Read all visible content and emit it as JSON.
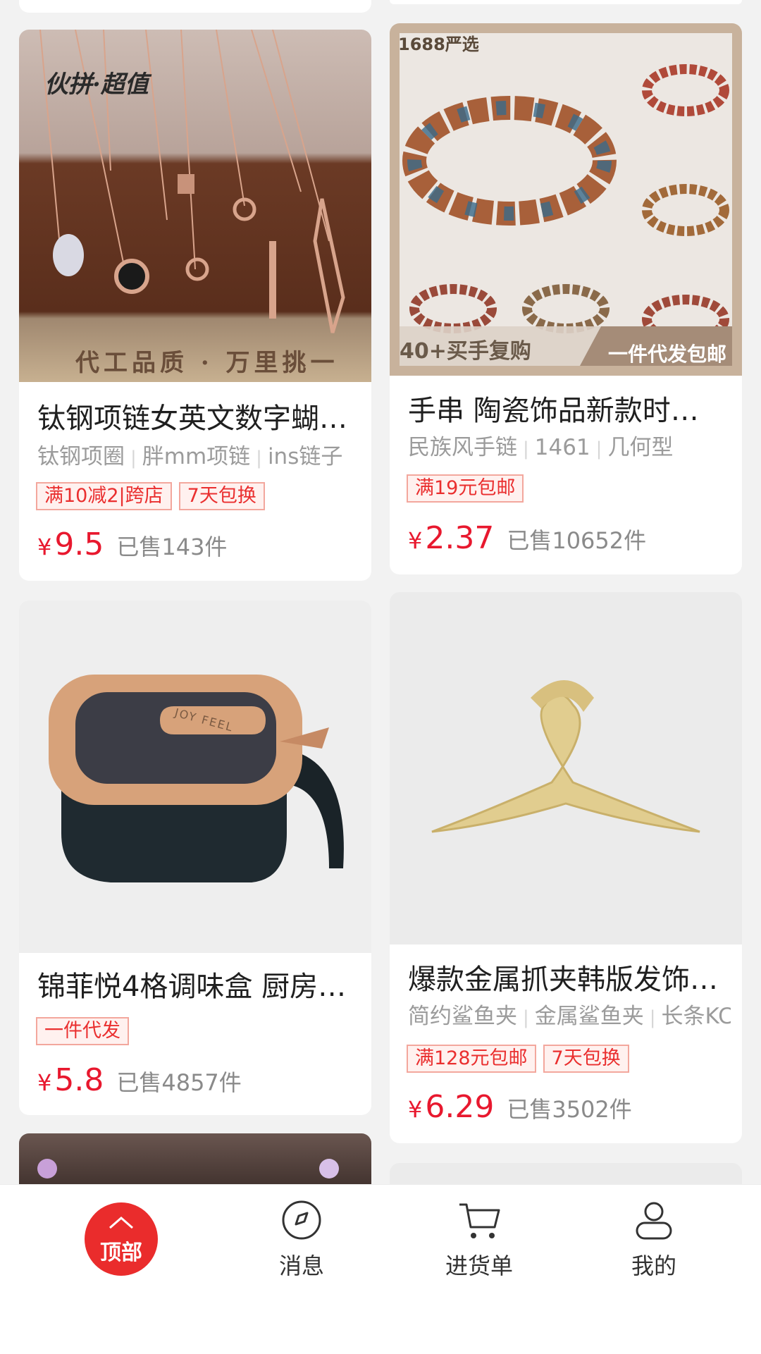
{
  "products": [
    {
      "title": "钛钢项链女英文数字蝴…",
      "tags": [
        "钛钢项圈",
        "胖mm项链",
        "ins链子"
      ],
      "promos": [
        "满10减2|跨店",
        "7天包换"
      ],
      "price_symbol": "¥",
      "price": "9.5",
      "sold": "已售143件",
      "image_badge_top": "伙拼·超值",
      "image_badge_bottom": "代工品质 · 万里挑一"
    },
    {
      "title": "手串 陶瓷饰品新款时…",
      "tags": [
        "民族风手链",
        "1461",
        "几何型"
      ],
      "promos": [
        "满19元包邮"
      ],
      "price_symbol": "¥",
      "price": "2.37",
      "sold": "已售10652件",
      "image_badge_top": "1688严选",
      "image_caption_left": "40+买手复购",
      "image_caption_right": "一件代发包邮"
    },
    {
      "title": "锦菲悦4格调味盒 厨房…",
      "tags": [],
      "promos": [
        "一件代发"
      ],
      "price_symbol": "¥",
      "price": "5.8",
      "sold": "已售4857件",
      "image_brand_text": "JOY FEEL"
    },
    {
      "title": "爆款金属抓夹韩版发饰…",
      "tags": [
        "简约鲨鱼夹",
        "金属鲨鱼夹",
        "长条KC"
      ],
      "promos": [
        "满128元包邮",
        "7天包换"
      ],
      "price_symbol": "¥",
      "price": "6.29",
      "sold": "已售3502件"
    }
  ],
  "tabbar": {
    "top_label": "顶部",
    "messages_label": "消息",
    "cart_label": "进货单",
    "mine_label": "我的"
  },
  "colors": {
    "accent": "#e8182e",
    "promo_border": "#f3a79d",
    "promo_bg": "#fff1ef",
    "top_button": "#ea2c2c"
  }
}
